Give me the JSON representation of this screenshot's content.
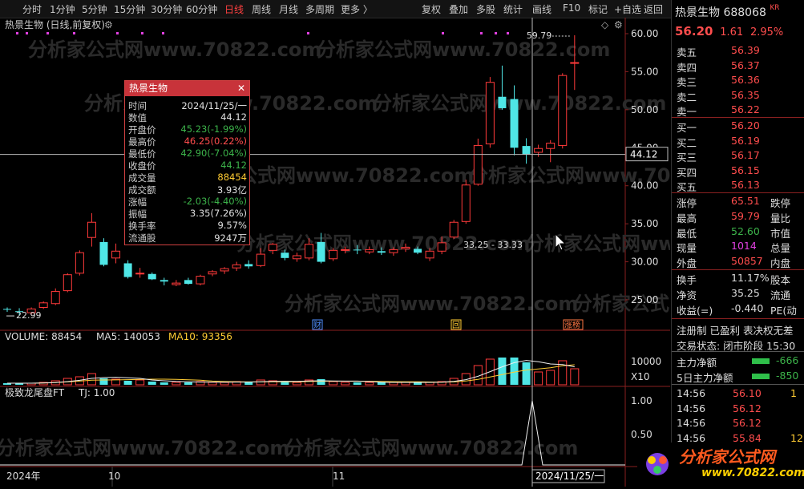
{
  "toolbar": {
    "items": [
      "分时",
      "1分钟",
      "5分钟",
      "15分钟",
      "30分钟",
      "60分钟",
      "日线",
      "周线",
      "月线",
      "多周期",
      "更多 〉"
    ],
    "active_index": 6,
    "right_items": [
      "复权",
      "叠加",
      "多股",
      "统计",
      "画线",
      "F10",
      "标记",
      "+自选",
      "返回"
    ]
  },
  "chart": {
    "title": "热景生物 (日线,前复权)",
    "watermark": "分析家公式网www.70822.com",
    "price_axis": [
      "60.00",
      "55.00",
      "50.00",
      "45.00",
      "40.00",
      "35.00",
      "30.00",
      "25.00"
    ],
    "crosshair_price": "44.12",
    "high_label": "59.79",
    "low_label": "22.99",
    "range_label": "33.25 - 33.33",
    "event_badges": [
      "财",
      "回",
      "涨榜"
    ],
    "volume_label": "VOLUME: 88454",
    "ma5_label": "MA5: 140053",
    "ma10_label": "MA10: 93356",
    "vol_axis": [
      "10000",
      "X10"
    ],
    "indicator_label": "极致龙尾盘FT",
    "tj_label": "TJ: 1.00",
    "ind_axis": [
      "1.00",
      "0.50"
    ],
    "date_axis": [
      "2024年",
      "10",
      "11",
      "2024/11/25/一"
    ]
  },
  "chart_data": {
    "type": "candlestick",
    "candles": [
      {
        "o": 23.8,
        "h": 24.0,
        "l": 23.4,
        "c": 23.7
      },
      {
        "o": 23.5,
        "h": 23.9,
        "l": 22.99,
        "c": 23.4
      },
      {
        "o": 23.3,
        "h": 24.0,
        "l": 23.0,
        "c": 23.8
      },
      {
        "o": 24.0,
        "h": 24.8,
        "l": 23.8,
        "c": 24.6
      },
      {
        "o": 24.5,
        "h": 26.5,
        "l": 24.3,
        "c": 26.1
      },
      {
        "o": 26.2,
        "h": 28.5,
        "l": 26.0,
        "c": 28.3
      },
      {
        "o": 28.5,
        "h": 31.5,
        "l": 28.2,
        "c": 31.2
      },
      {
        "o": 33.2,
        "h": 36.4,
        "l": 32.0,
        "c": 35.2
      },
      {
        "o": 32.6,
        "h": 33.1,
        "l": 29.4,
        "c": 29.6
      },
      {
        "o": 30.5,
        "h": 32.4,
        "l": 29.8,
        "c": 31.4
      },
      {
        "o": 29.8,
        "h": 30.2,
        "l": 27.8,
        "c": 28.0
      },
      {
        "o": 28.4,
        "h": 29.2,
        "l": 27.9,
        "c": 28.5
      },
      {
        "o": 28.4,
        "h": 28.6,
        "l": 27.6,
        "c": 27.7
      },
      {
        "o": 27.6,
        "h": 27.9,
        "l": 26.9,
        "c": 27.4
      },
      {
        "o": 27.0,
        "h": 27.6,
        "l": 26.8,
        "c": 27.2
      },
      {
        "o": 27.6,
        "h": 27.9,
        "l": 27.0,
        "c": 27.1
      },
      {
        "o": 27.1,
        "h": 28.3,
        "l": 26.9,
        "c": 28.1
      },
      {
        "o": 28.4,
        "h": 28.9,
        "l": 28.1,
        "c": 28.7
      },
      {
        "o": 28.8,
        "h": 29.3,
        "l": 28.4,
        "c": 29.1
      },
      {
        "o": 29.2,
        "h": 30.0,
        "l": 28.8,
        "c": 29.6
      },
      {
        "o": 29.7,
        "h": 30.2,
        "l": 29.1,
        "c": 29.4
      },
      {
        "o": 29.5,
        "h": 31.8,
        "l": 29.3,
        "c": 31.0
      },
      {
        "o": 31.5,
        "h": 32.5,
        "l": 31.0,
        "c": 32.3
      },
      {
        "o": 31.2,
        "h": 31.6,
        "l": 30.2,
        "c": 30.5
      },
      {
        "o": 30.4,
        "h": 31.2,
        "l": 30.0,
        "c": 30.8
      },
      {
        "o": 30.5,
        "h": 33.1,
        "l": 30.2,
        "c": 32.3
      },
      {
        "o": 32.6,
        "h": 33.8,
        "l": 29.8,
        "c": 30.0
      },
      {
        "o": 30.4,
        "h": 31.8,
        "l": 30.1,
        "c": 31.5
      },
      {
        "o": 31.5,
        "h": 32.0,
        "l": 31.1,
        "c": 31.6
      },
      {
        "o": 31.6,
        "h": 32.2,
        "l": 31.0,
        "c": 31.5
      },
      {
        "o": 31.3,
        "h": 32.0,
        "l": 31.0,
        "c": 31.6
      },
      {
        "o": 31.4,
        "h": 31.9,
        "l": 30.9,
        "c": 31.2
      },
      {
        "o": 31.2,
        "h": 31.9,
        "l": 30.8,
        "c": 31.6
      },
      {
        "o": 31.7,
        "h": 32.4,
        "l": 31.3,
        "c": 31.9
      },
      {
        "o": 31.7,
        "h": 32.0,
        "l": 31.0,
        "c": 31.2
      },
      {
        "o": 30.5,
        "h": 31.8,
        "l": 30.1,
        "c": 31.4
      },
      {
        "o": 31.4,
        "h": 33.33,
        "l": 31.0,
        "c": 32.5
      },
      {
        "o": 33.25,
        "h": 35.5,
        "l": 33.0,
        "c": 35.2
      },
      {
        "o": 35.3,
        "h": 40.8,
        "l": 35.0,
        "c": 40.1
      },
      {
        "o": 40.2,
        "h": 46.2,
        "l": 40.0,
        "c": 45.3
      },
      {
        "o": 45.5,
        "h": 54.3,
        "l": 45.0,
        "c": 53.6
      },
      {
        "o": 51.7,
        "h": 55.8,
        "l": 50.0,
        "c": 50.2
      },
      {
        "o": 51.4,
        "h": 53.2,
        "l": 44.0,
        "c": 45.0
      },
      {
        "o": 45.23,
        "h": 46.25,
        "l": 42.9,
        "c": 44.12
      },
      {
        "o": 44.4,
        "h": 45.4,
        "l": 43.8,
        "c": 44.9
      },
      {
        "o": 44.9,
        "h": 46.0,
        "l": 43.1,
        "c": 45.6
      },
      {
        "o": 45.3,
        "h": 54.8,
        "l": 44.9,
        "c": 54.5
      },
      {
        "o": 56.2,
        "h": 59.79,
        "l": 52.6,
        "c": 56.2
      }
    ],
    "volume_ma5": 140053,
    "volume_ma10": 93356,
    "last_volume": 88454,
    "tj_value": 1.0
  },
  "popup": {
    "title": "热景生物",
    "rows": [
      {
        "label": "时间",
        "value": "2024/11/25/一",
        "color": "white"
      },
      {
        "label": "数值",
        "value": "44.12",
        "color": "white"
      },
      {
        "label": "开盘价",
        "value": "45.23(-1.99%)",
        "color": "green"
      },
      {
        "label": "最高价",
        "value": "46.25(0.22%)",
        "color": "red"
      },
      {
        "label": "最低价",
        "value": "42.90(-7.04%)",
        "color": "green"
      },
      {
        "label": "收盘价",
        "value": "44.12",
        "color": "green"
      },
      {
        "label": "成交量",
        "value": "88454",
        "color": "yellow"
      },
      {
        "label": "成交额",
        "value": "3.93亿",
        "color": "white"
      },
      {
        "label": "涨幅",
        "value": "-2.03(-4.40%)",
        "color": "green"
      },
      {
        "label": "振幅",
        "value": "3.35(7.26%)",
        "color": "white"
      },
      {
        "label": "换手率",
        "value": "9.57%",
        "color": "white"
      },
      {
        "label": "流通股",
        "value": "9247万",
        "color": "white"
      }
    ]
  },
  "quote": {
    "name": "热景生物",
    "code": "688068",
    "tag": "KR",
    "price": "56.20",
    "change": "1.61",
    "pct": "2.95%",
    "asks": [
      {
        "label": "卖五",
        "price": "56.39"
      },
      {
        "label": "卖四",
        "price": "56.37"
      },
      {
        "label": "卖三",
        "price": "56.36"
      },
      {
        "label": "卖二",
        "price": "56.35"
      },
      {
        "label": "卖一",
        "price": "56.22"
      }
    ],
    "bids": [
      {
        "label": "买一",
        "price": "56.20"
      },
      {
        "label": "买二",
        "price": "56.19"
      },
      {
        "label": "买三",
        "price": "56.17"
      },
      {
        "label": "买四",
        "price": "56.15"
      },
      {
        "label": "买五",
        "price": "56.13"
      }
    ],
    "stats": [
      {
        "l1": "涨停",
        "v1": "65.51",
        "c1": "red",
        "l2": "跌停"
      },
      {
        "l1": "最高",
        "v1": "59.79",
        "c1": "red",
        "l2": "量比"
      },
      {
        "l1": "最低",
        "v1": "52.60",
        "c1": "green",
        "l2": "市值"
      },
      {
        "l1": "现量",
        "v1": "1014",
        "c1": "magenta",
        "l2": "总量"
      },
      {
        "l1": "外盘",
        "v1": "50857",
        "c1": "red",
        "l2": "内盘"
      }
    ],
    "stats2": [
      {
        "l1": "换手",
        "v1": "11.17%",
        "l2": "股本"
      },
      {
        "l1": "净资",
        "v1": "35.25",
        "l2": "流通"
      },
      {
        "l1": "收益(=)",
        "v1": "-0.440",
        "l2": "PE(动"
      }
    ],
    "info_line1": "注册制 已盈利 表决权无差",
    "info_line2": "交易状态: 闭市阶段 15:30",
    "flows": [
      {
        "label": "主力净额",
        "value": "-666"
      },
      {
        "label": "5日主力净额",
        "value": "-850"
      }
    ],
    "ticks": [
      {
        "t": "14:56",
        "p": "56.10",
        "c": "red",
        "v": "1"
      },
      {
        "t": "14:56",
        "p": "56.12",
        "c": "red",
        "v": ""
      },
      {
        "t": "14:56",
        "p": "56.12",
        "c": "red",
        "v": ""
      },
      {
        "t": "14:56",
        "p": "55.84",
        "c": "red",
        "v": "12"
      }
    ]
  },
  "logo": {
    "text": "分析家公式网",
    "url": "www.70822.com"
  }
}
